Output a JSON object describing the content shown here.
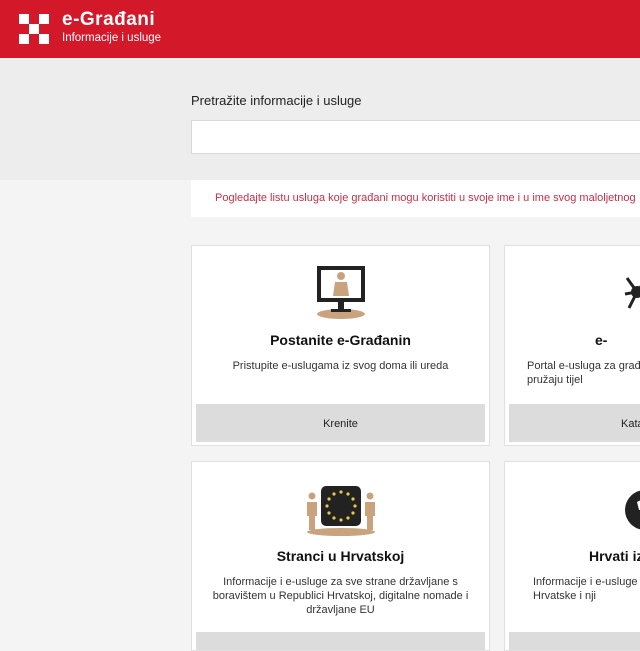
{
  "header": {
    "title": "e-Građani",
    "subtitle": "Informacije i usluge"
  },
  "search": {
    "label": "Pretražite informacije i usluge",
    "value": "",
    "placeholder": ""
  },
  "notice": {
    "text": "Pogledajte listu usluga koje građani mogu koristiti u svoje ime i u ime svog maloljetnog"
  },
  "cards": [
    {
      "title": "Postanite e-Građanin",
      "description": "Pristupite e-uslugama iz svog doma ili ureda",
      "button": "Krenite",
      "icon": "computer-person-icon"
    },
    {
      "title": "e-",
      "description": "Portal e-usluga za građ pružaju tijel",
      "button": "Kata",
      "icon": "network-icon"
    },
    {
      "title": "Stranci u Hrvatskoj",
      "description": "Informacije i e-usluge za sve strane državljane s boravištem u Republici Hrvatskoj, digitalne nomade i državljane EU",
      "button": "",
      "icon": "eu-flag-people-icon"
    },
    {
      "title": "Hrvati izv",
      "description": "Informacije i e-usluge Hrvatske i nji",
      "button": "",
      "icon": "globe-icon"
    }
  ],
  "colors": {
    "brand_red": "#d3182a",
    "notice_text": "#c0314a",
    "icon_tan": "#c9a27e",
    "icon_dark": "#222222"
  }
}
